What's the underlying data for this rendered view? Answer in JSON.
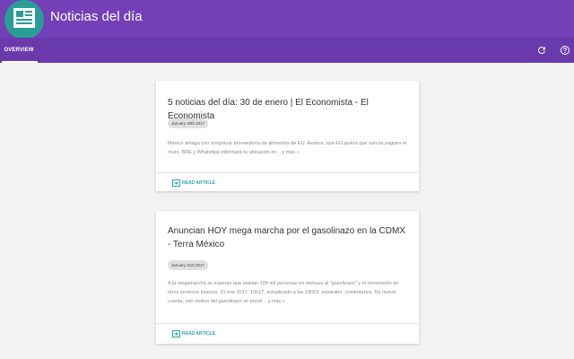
{
  "app": {
    "title": "Noticias del día"
  },
  "tabs": [
    {
      "label": "OVERVIEW"
    }
  ],
  "toolbar": {
    "refresh_icon": "refresh-icon",
    "help_icon": "help-icon"
  },
  "colors": {
    "header": "#7340b8",
    "tabbar": "#6a3aad",
    "logo": "#2a9d96",
    "accent": "#2aa5b0"
  },
  "articles": [
    {
      "title": "5 noticias del día: 30 de enero | El Economista - El Economista",
      "date": "January 30th 2017",
      "summary": "México amaga con remplazar proveeduría de alimentos de EU. Avance, que EU quiera que narcos paguen el muro. BRE y WhatsApp informará tu ubicación en ...y más »",
      "action": "READ ARTICLE"
    },
    {
      "title": "Anuncian HOY mega marcha por el gasolinazo en la CDMX - Terra México",
      "date": "January 31st 2017",
      "summary": "A la megamarcha se esperan que asistan 100 mil personas en rechazo al \"gasolinazo\" y el incremento de otros servicios básicos. 31 ene 2017. 10h17. actualizado a las 13h53. separator; comentarios. De nueva cuenta, con motivo del gasolinazo se prevé ...y más »",
      "action": "READ ARTICLE"
    }
  ]
}
